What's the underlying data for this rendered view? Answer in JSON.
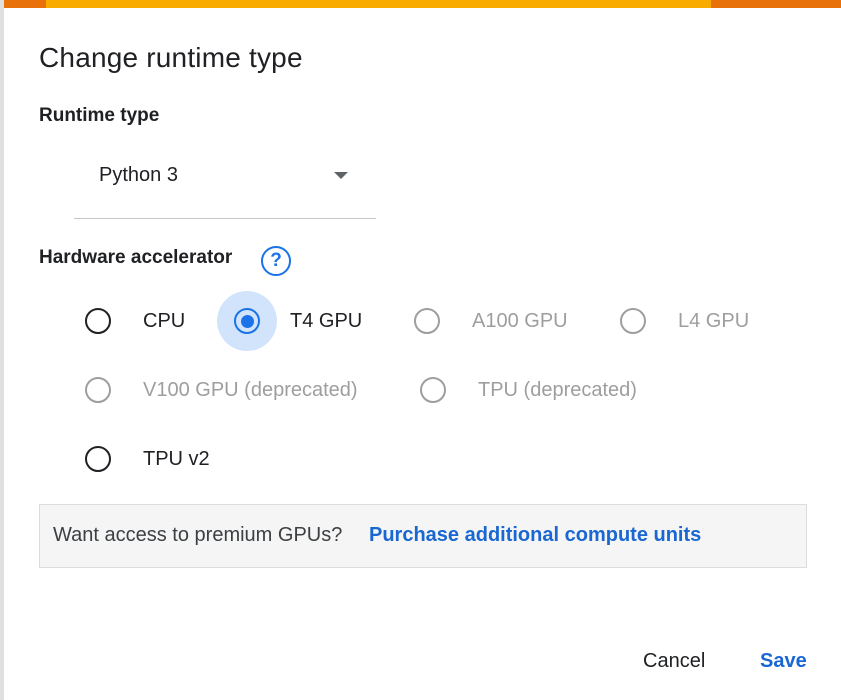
{
  "dialog": {
    "title": "Change runtime type"
  },
  "runtime": {
    "label": "Runtime type",
    "selected": "Python 3"
  },
  "hardware": {
    "label": "Hardware accelerator",
    "help_icon": "?",
    "options": [
      {
        "label": "CPU",
        "selected": false,
        "disabled": false
      },
      {
        "label": "T4 GPU",
        "selected": true,
        "disabled": false
      },
      {
        "label": "A100 GPU",
        "selected": false,
        "disabled": true
      },
      {
        "label": "L4 GPU",
        "selected": false,
        "disabled": true
      },
      {
        "label": "V100 GPU (deprecated)",
        "selected": false,
        "disabled": true
      },
      {
        "label": "TPU (deprecated)",
        "selected": false,
        "disabled": true
      },
      {
        "label": "TPU v2",
        "selected": false,
        "disabled": false
      }
    ]
  },
  "premium": {
    "text": "Want access to premium GPUs?",
    "link": "Purchase additional compute units"
  },
  "actions": {
    "cancel": "Cancel",
    "save": "Save"
  },
  "colors": {
    "accent": "#1a73e8",
    "link": "#1967d2",
    "topbar": "#f9ab00",
    "topbar_accent": "#e8710a"
  }
}
